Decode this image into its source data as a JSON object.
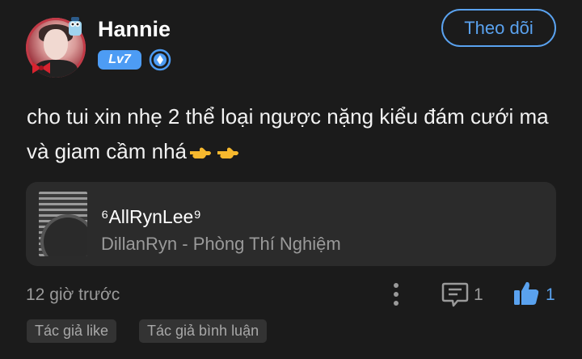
{
  "user": {
    "name": "Hannie",
    "level": "Lv7",
    "follow_label": "Theo dõi"
  },
  "post": {
    "text": "cho tui xin nhẹ 2 thể loại ngược nặng kiểu đám cưới ma và giam cầm nhá"
  },
  "song": {
    "title": "⁶AllRynLee⁹",
    "subtitle": "DillanRyn - Phòng Thí Nghiệm"
  },
  "meta": {
    "timestamp": "12 giờ trước",
    "comment_count": "1",
    "like_count": "1"
  },
  "tags": [
    "Tác giả like",
    "Tác giả bình luận"
  ],
  "colors": {
    "background": "#1b1b1b",
    "accent_blue": "#5aa2ef",
    "level_badge": "#4d9cf4",
    "card": "#2b2b2b",
    "muted_text": "#9a9a9a"
  },
  "icons": [
    "avatar-frame-decoration",
    "verified-badge-icon",
    "hand-pointing-emoji",
    "more-vertical-icon",
    "comment-icon",
    "thumbs-up-icon"
  ]
}
